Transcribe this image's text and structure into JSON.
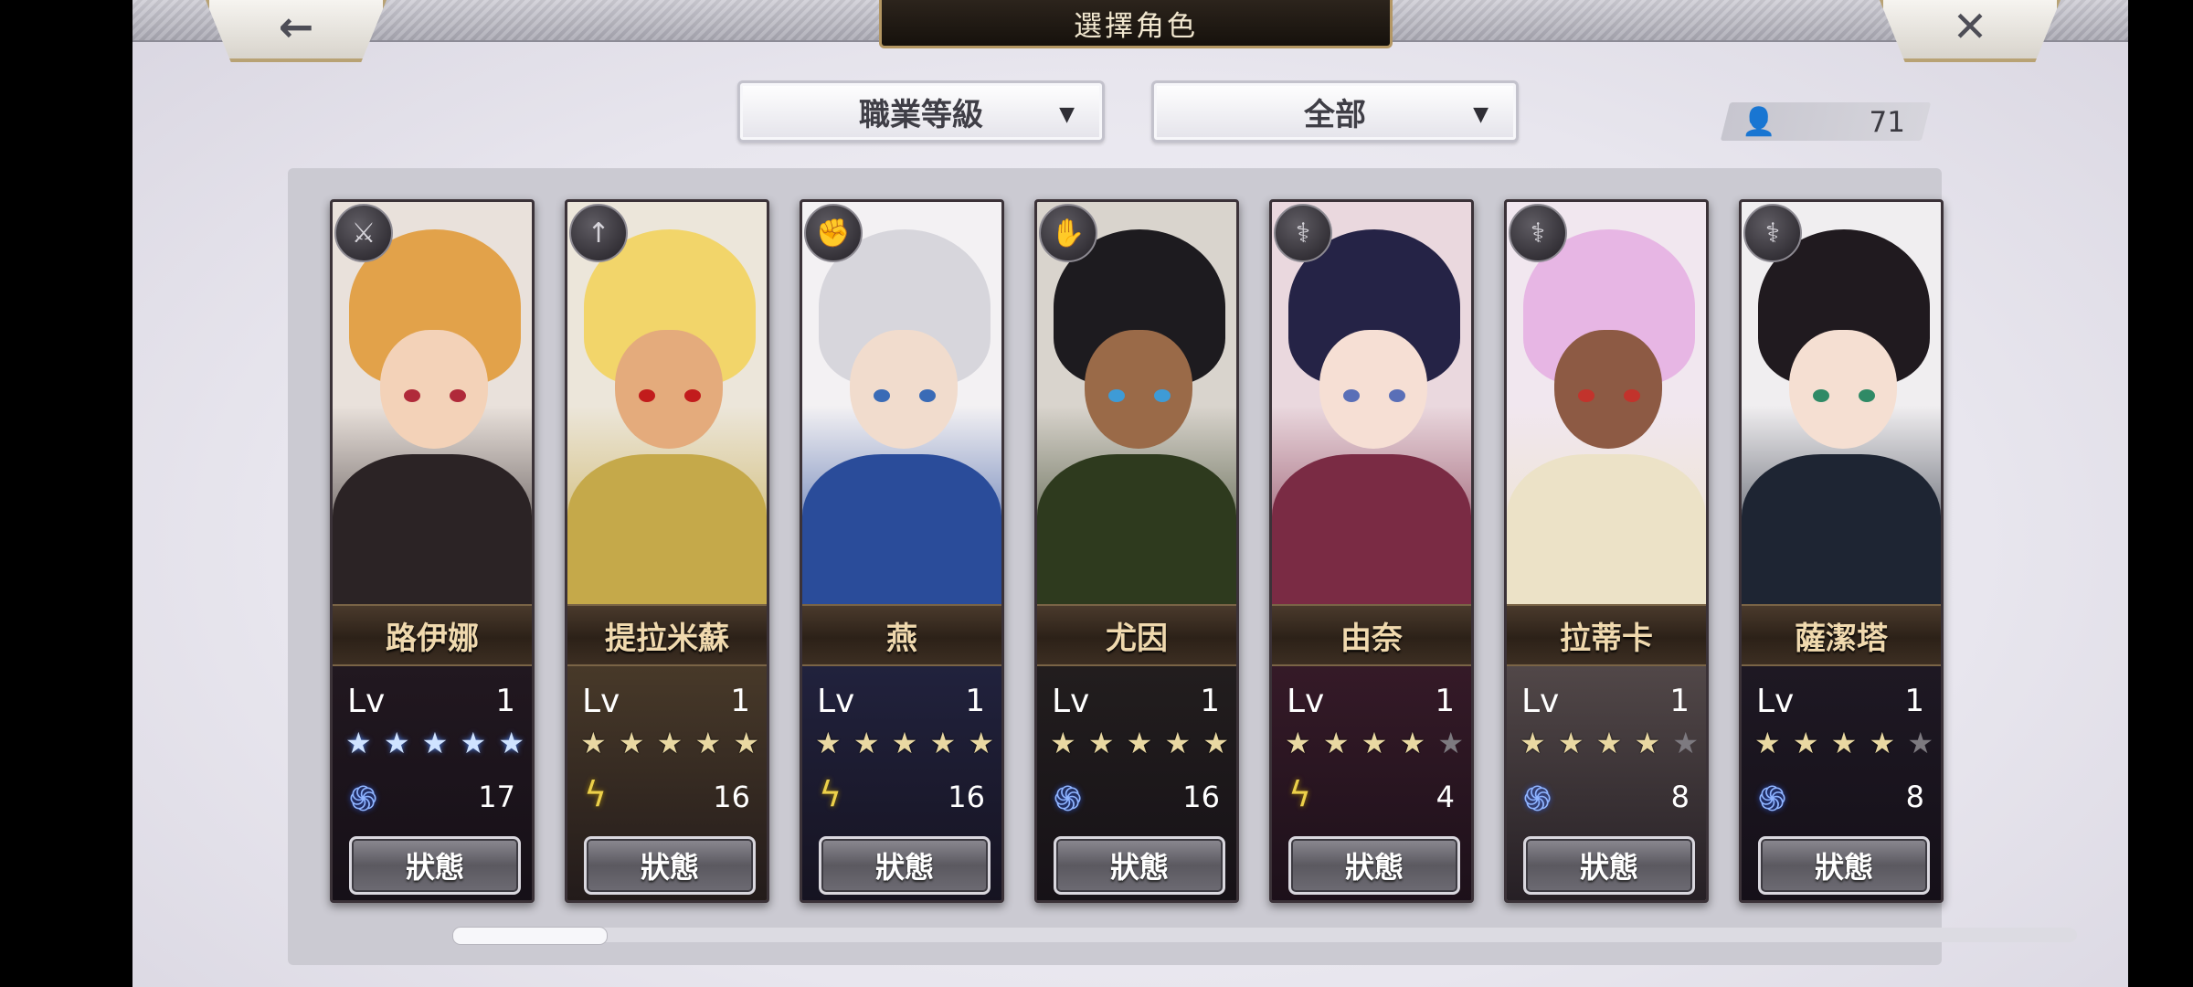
{
  "header": {
    "title": "選擇角色",
    "back_icon": "left-arrow-icon",
    "close_icon": "close-x-icon"
  },
  "filters": {
    "class_level": "職業等級",
    "category": "全部"
  },
  "owned_count": "71",
  "characters": [
    {
      "name": "路伊娜",
      "lv_label": "Lv",
      "level": "1",
      "stars": 5,
      "rarity_style": "blue",
      "element": "wind",
      "element_value": "17",
      "weapon": "sword-icon",
      "status_label": "狀態",
      "palette": {
        "hair": "#e2a24a",
        "skin": "#f3d2b8",
        "outfit": "#2b2325",
        "bg": "#e9e1db",
        "eye": "#b02a3a"
      }
    },
    {
      "name": "提拉米蘇",
      "lv_label": "Lv",
      "level": "1",
      "stars": 5,
      "rarity_style": "gold",
      "element": "thunder",
      "element_value": "16",
      "weapon": "spear-icon",
      "status_label": "狀態",
      "palette": {
        "hair": "#f2d56a",
        "skin": "#e4ab7c",
        "outfit": "#c5a94a",
        "bg": "#ece6da",
        "eye": "#c21c1c"
      }
    },
    {
      "name": "燕",
      "lv_label": "Lv",
      "level": "1",
      "stars": 5,
      "rarity_style": "gold",
      "element": "thunder",
      "element_value": "16",
      "weapon": "fist-icon",
      "status_label": "狀態",
      "palette": {
        "hair": "#d7d6dc",
        "skin": "#f1dccd",
        "outfit": "#2a4c9a",
        "bg": "#f3f1f3",
        "eye": "#3a6bb6"
      }
    },
    {
      "name": "尤因",
      "lv_label": "Lv",
      "level": "1",
      "stars": 5,
      "rarity_style": "gold",
      "element": "wind",
      "element_value": "16",
      "weapon": "gauntlet-icon",
      "status_label": "狀態",
      "palette": {
        "hair": "#1d1b1f",
        "skin": "#9a6a48",
        "outfit": "#2e3a1e",
        "bg": "#d9d4cd",
        "eye": "#3e9bd6"
      }
    },
    {
      "name": "由奈",
      "lv_label": "Lv",
      "level": "1",
      "stars": 4,
      "rarity_style": "gold",
      "element": "thunder",
      "element_value": "4",
      "weapon": "staff-icon",
      "status_label": "狀態",
      "palette": {
        "hair": "#252346",
        "skin": "#f6dfd4",
        "outfit": "#7a2b44",
        "bg": "#ead8de",
        "eye": "#5a6fb7"
      }
    },
    {
      "name": "拉蒂卡",
      "lv_label": "Lv",
      "level": "1",
      "stars": 4,
      "rarity_style": "gold",
      "element": "wind",
      "element_value": "8",
      "weapon": "staff-icon",
      "status_label": "狀態",
      "palette": {
        "hair": "#e7b6e4",
        "skin": "#8d5a44",
        "outfit": "#ece2c7",
        "bg": "#f1e7ef",
        "eye": "#c2332c"
      }
    },
    {
      "name": "薩潔塔",
      "lv_label": "Lv",
      "level": "1",
      "stars": 4,
      "rarity_style": "gold",
      "element": "wind",
      "element_value": "8",
      "weapon": "staff-icon",
      "status_label": "狀態",
      "palette": {
        "hair": "#201a1f",
        "skin": "#f5dfd2",
        "outfit": "#1e2533",
        "bg": "#f0eef0",
        "eye": "#2f8a66"
      }
    }
  ],
  "scroll": {
    "position_fraction": 0.0
  }
}
